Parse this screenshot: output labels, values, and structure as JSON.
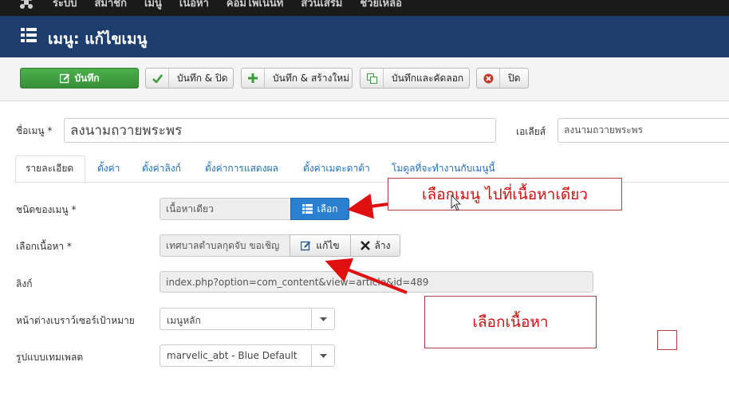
{
  "topnav": {
    "items": [
      "ระบบ",
      "สมาชิก",
      "เมนู",
      "เนื้อหา",
      "คอมโพเนนท์",
      "ส่วนเสริม",
      "ช่วยเหลือ"
    ]
  },
  "title": "เมนู: แก้ไขเมนู",
  "toolbar": {
    "save": "บันทึก",
    "save_close": "บันทึก & ปิด",
    "save_new": "บันทึก & สร้างใหม่",
    "save_copy": "บันทึกและคัดลอก",
    "close": "ปิด"
  },
  "form": {
    "menu_title_label": "ชื่อเมนู *",
    "menu_title_value": "ลงนามถวายพระพร",
    "alias_label": "เอเลียส์",
    "alias_value": "ลงนามถวายพระพร",
    "tabs": [
      "รายละเอียด",
      "ตั้งค่า",
      "ตั้งค่าลิงก์",
      "ตั้งค่าการแสดงผล",
      "ตั้งค่าเมตะดาต้า",
      "โมดูลที่จะทำงานกับเมนูนี้"
    ],
    "menu_type_label": "ชนิดของเมนู *",
    "menu_type_value": "เนื้อหาเดียว",
    "select_button": "เลือก",
    "content_label": "เลือกเนื้อหา *",
    "content_value": "เทศบาลตำบลกุดจับ ขอเชิญ",
    "edit_button": "แก้ไข",
    "clear_button": "ล้าง",
    "link_label": "ลิงก์",
    "link_value": "index.php?option=com_content&view=article&id=489",
    "target_label": "หน้าต่างเบราว์เซอร์เป้าหมาย",
    "target_value": "เมนูหลัก",
    "template_label": "รูปแบบเทมเพลต",
    "template_value": "marvelic_abt - Blue Default"
  },
  "annotations": {
    "note1": "เลือกเมนู ไปที่เนื้อหาเดียว",
    "note2": "เลือกเนื้อหา"
  },
  "colors": {
    "titlebar": "#1c3d6e",
    "save_green": "#3c9c3c",
    "select_blue": "#2a7fd0",
    "annotation_red": "#cc1111"
  }
}
